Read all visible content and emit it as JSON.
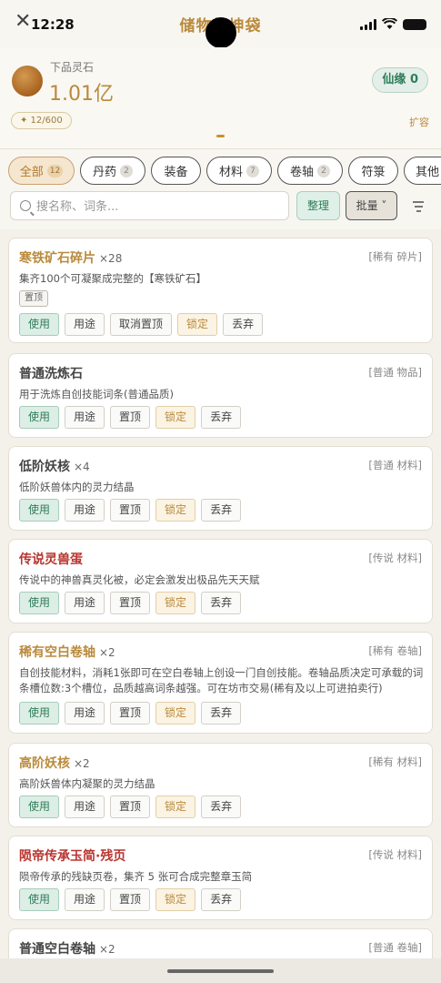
{
  "status": {
    "time": "12:28"
  },
  "header": {
    "title": "储物乾坤袋",
    "stone_label": "下品灵石",
    "stone_amount": "1.01亿",
    "xianyuan": "仙缘 0",
    "capacity": "✦ 12/600",
    "expand": "扩容"
  },
  "tabs": [
    {
      "label": "全部",
      "count": "12"
    },
    {
      "label": "丹药",
      "count": "2"
    },
    {
      "label": "装备",
      "count": ""
    },
    {
      "label": "材料",
      "count": "7"
    },
    {
      "label": "卷轴",
      "count": "2"
    },
    {
      "label": "符箓",
      "count": ""
    },
    {
      "label": "其他",
      "count": ""
    }
  ],
  "search": {
    "placeholder": "搜名称、词条...",
    "sort_label": "整理",
    "batch_label": "批量 ˅"
  },
  "actions": {
    "use": "使用",
    "purpose": "用途",
    "pin": "置顶",
    "unpin": "取消置顶",
    "lock": "锁定",
    "discard": "丢弃"
  },
  "items": [
    {
      "name": "寒铁矿石碎片",
      "qty": "×28",
      "tag": "[稀有 碎片]",
      "desc": "集齐100个可凝聚成完整的【寒铁矿石】",
      "pinned": "置顶"
    },
    {
      "name": "普通洗炼石",
      "qty": "",
      "tag": "[普通 物品]",
      "desc": "用于洗炼自创技能词条(普通品质)"
    },
    {
      "name": "低阶妖核",
      "qty": "×4",
      "tag": "[普通 材料]",
      "desc": "低阶妖兽体内的灵力结晶"
    },
    {
      "name": "传说灵兽蛋",
      "qty": "",
      "tag": "[传说 材料]",
      "desc": "传说中的神兽真灵化被，必定会激发出极品先天天赋"
    },
    {
      "name": "稀有空白卷轴",
      "qty": "×2",
      "tag": "[稀有 卷轴]",
      "desc": "自创技能材料，消耗1张即可在空白卷轴上创设一门自创技能。卷轴品质决定可承载的词条槽位数:3个槽位，品质越高词条越强。可在坊市交易(稀有及以上可进拍卖行)"
    },
    {
      "name": "高阶妖核",
      "qty": "×2",
      "tag": "[稀有 材料]",
      "desc": "高阶妖兽体内凝聚的灵力结晶"
    },
    {
      "name": "陨帝传承玉简·残页",
      "qty": "",
      "tag": "[传说 材料]",
      "desc": "陨帝传承的残缺页卷，集齐 5 张可合成完整章玉简"
    },
    {
      "name": "普通空白卷轴",
      "qty": "×2",
      "tag": "[普通 卷轴]",
      "desc": ""
    }
  ]
}
